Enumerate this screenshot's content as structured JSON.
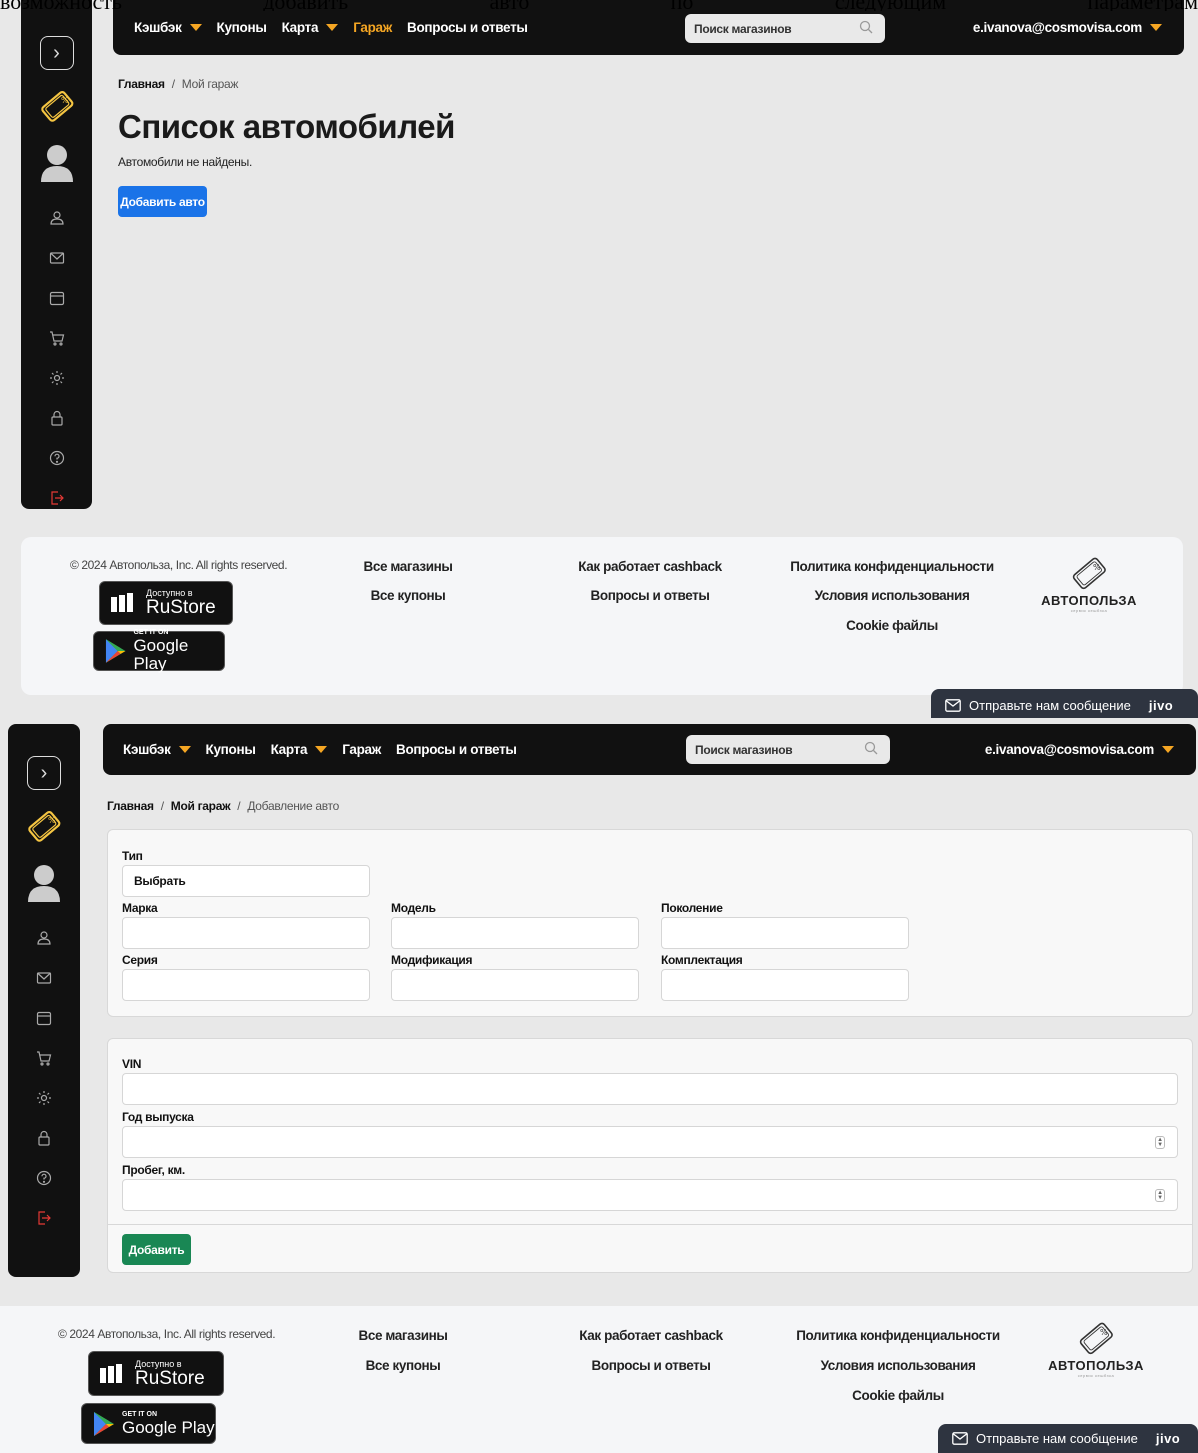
{
  "top_cut_text": [
    "возможность",
    "добавить",
    "авто",
    "по",
    "следующим",
    "параметрам"
  ],
  "nav": {
    "cashback": "Кэшбэк",
    "coupons": "Купоны",
    "map": "Карта",
    "garage": "Гараж",
    "faq": "Вопросы и ответы",
    "search_placeholder": "Поиск магазинов",
    "user_email": "e.ivanova@cosmovisa.com"
  },
  "sidebar_icons": [
    "user-icon",
    "mail-icon",
    "calendar-icon",
    "cart-icon",
    "settings-icon",
    "lock-icon",
    "help-icon",
    "logout-icon"
  ],
  "garage_list": {
    "breadcrumb": [
      "Главная",
      "/",
      "Мой гараж"
    ],
    "title": "Список автомобилей",
    "empty_text": "Автомобили не найдены.",
    "add_button": "Добавить авто"
  },
  "add_car": {
    "breadcrumb": [
      "Главная",
      "/",
      "Мой гараж",
      "/",
      "Добавление авто"
    ],
    "type_label": "Тип",
    "type_value": "Выбрать",
    "brand_label": "Марка",
    "model_label": "Модель",
    "generation_label": "Поколение",
    "series_label": "Серия",
    "modification_label": "Модификация",
    "equipment_label": "Комплектация",
    "vin_label": "VIN",
    "year_label": "Год выпуска",
    "mileage_label": "Пробег, км.",
    "submit_button": "Добавить"
  },
  "footer": {
    "copyright": "© 2024 Автопольза, Inc. All rights reserved.",
    "all_shops": "Все магазины",
    "all_coupons": "Все купоны",
    "how_cashback": "Как работает cashback",
    "faq": "Вопросы и ответы",
    "privacy": "Политика конфиденциальности",
    "terms": "Условия использования",
    "cookies": "Cookie файлы",
    "rustore_small": "Доступно в",
    "rustore_big": "RuStore",
    "gplay_small": "GET IT ON",
    "gplay_big": "Google Play",
    "brand_name": "АВТОПОЛЬЗА",
    "brand_tagline": "сервис кешбэка"
  },
  "chat": {
    "label": "Отправьте нам сообщение",
    "brand": "jivo"
  },
  "colors": {
    "navbar_bg": "#111111",
    "accent_orange": "#f5a623",
    "primary_blue": "#1a73e8",
    "success_green": "#198754",
    "logout_red": "#e53935"
  }
}
